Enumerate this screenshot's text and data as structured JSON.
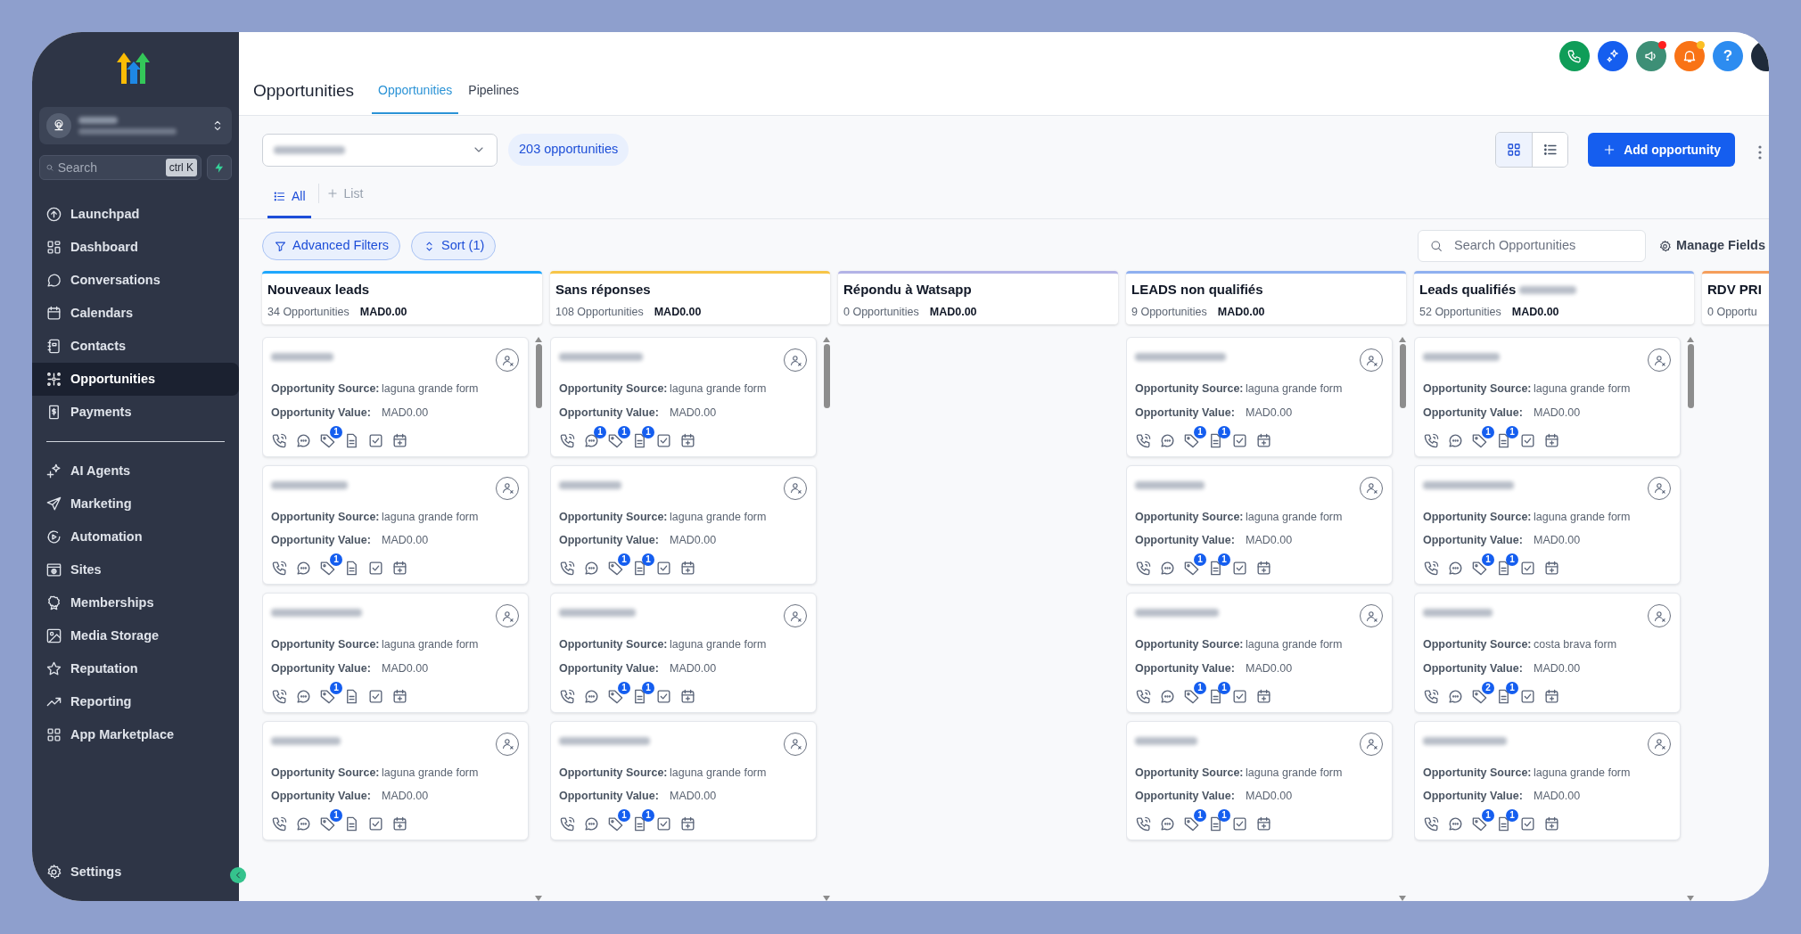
{
  "sidebar": {
    "search": {
      "placeholder": "Search",
      "shortcut": "ctrl K"
    },
    "nav_groups": [
      [
        {
          "label": "Launchpad",
          "selected": false
        },
        {
          "label": "Dashboard",
          "selected": false
        },
        {
          "label": "Conversations",
          "selected": false
        },
        {
          "label": "Calendars",
          "selected": false
        },
        {
          "label": "Contacts",
          "selected": false
        },
        {
          "label": "Opportunities",
          "selected": true
        },
        {
          "label": "Payments",
          "selected": false
        }
      ],
      [
        {
          "label": "AI Agents",
          "selected": false
        },
        {
          "label": "Marketing",
          "selected": false
        },
        {
          "label": "Automation",
          "selected": false
        },
        {
          "label": "Sites",
          "selected": false
        },
        {
          "label": "Memberships",
          "selected": false
        },
        {
          "label": "Media Storage",
          "selected": false
        },
        {
          "label": "Reputation",
          "selected": false
        },
        {
          "label": "Reporting",
          "selected": false
        },
        {
          "label": "App Marketplace",
          "selected": false
        }
      ]
    ],
    "settings": "Settings"
  },
  "header": {
    "title": "Opportunities",
    "tabs": [
      {
        "label": "Opportunities",
        "selected": true
      },
      {
        "label": "Pipelines",
        "selected": false
      }
    ],
    "help_label": "?"
  },
  "toolbar": {
    "count": "203 opportunities",
    "views": [
      {
        "kind": "grid",
        "selected": true
      },
      {
        "kind": "list",
        "selected": false
      }
    ],
    "add_button": "Add opportunity"
  },
  "smart_lists": {
    "items": [
      {
        "label": "All",
        "selected": true
      }
    ],
    "add_label": "List"
  },
  "filters": {
    "advanced": "Advanced Filters",
    "sort": "Sort (1)",
    "search_placeholder": "Search Opportunities",
    "manage_fields": "Manage Fields"
  },
  "columns": [
    {
      "title": "Nouveaux leads",
      "count": "34 Opportunities",
      "value": "MAD0.00",
      "color": "#1ea7fd",
      "cards": [
        {
          "source_label": "Opportunity Source:",
          "source": "laguna grande form",
          "value_label": "Opportunity Value:",
          "value": "MAD0.00",
          "badges": {
            "tag": "1"
          }
        },
        {
          "source_label": "Opportunity Source:",
          "source": "laguna grande form",
          "value_label": "Opportunity Value:",
          "value": "MAD0.00",
          "badges": {
            "tag": "1"
          }
        },
        {
          "source_label": "Opportunity Source:",
          "source": "laguna grande form",
          "value_label": "Opportunity Value:",
          "value": "MAD0.00",
          "badges": {
            "tag": "1"
          }
        },
        {
          "source_label": "Opportunity Source:",
          "source": "laguna grande form",
          "value_label": "Opportunity Value:",
          "value": "MAD0.00",
          "badges": {
            "tag": "1"
          }
        }
      ]
    },
    {
      "title": "Sans réponses",
      "count": "108 Opportunities",
      "value": "MAD0.00",
      "color": "#f7c548",
      "cards": [
        {
          "source_label": "Opportunity Source:",
          "source": "laguna grande form",
          "value_label": "Opportunity Value:",
          "value": "MAD0.00",
          "badges": {
            "chat": "1",
            "tag": "1",
            "note": "1"
          }
        },
        {
          "source_label": "Opportunity Source:",
          "source": "laguna grande form",
          "value_label": "Opportunity Value:",
          "value": "MAD0.00",
          "badges": {
            "tag": "1",
            "note": "1"
          }
        },
        {
          "source_label": "Opportunity Source:",
          "source": "laguna grande form",
          "value_label": "Opportunity Value:",
          "value": "MAD0.00",
          "badges": {
            "tag": "1",
            "note": "1"
          }
        },
        {
          "source_label": "Opportunity Source:",
          "source": "laguna grande form",
          "value_label": "Opportunity Value:",
          "value": "MAD0.00",
          "badges": {
            "tag": "1",
            "note": "1"
          }
        }
      ]
    },
    {
      "title": "Répondu à Watsapp",
      "count": "0 Opportunities",
      "value": "MAD0.00",
      "color": "#b3b3e6"
    },
    {
      "title": "LEADS non qualifiés",
      "count": "9 Opportunities",
      "value": "MAD0.00",
      "color": "#8fb0f0",
      "cards": [
        {
          "source_label": "Opportunity Source:",
          "source": "laguna grande form",
          "value_label": "Opportunity Value:",
          "value": "MAD0.00",
          "badges": {
            "tag": "1",
            "note": "1"
          }
        },
        {
          "source_label": "Opportunity Source:",
          "source": "laguna grande form",
          "value_label": "Opportunity Value:",
          "value": "MAD0.00",
          "badges": {
            "tag": "1",
            "note": "1"
          }
        },
        {
          "source_label": "Opportunity Source:",
          "source": "laguna grande form",
          "value_label": "Opportunity Value:",
          "value": "MAD0.00",
          "badges": {
            "tag": "1",
            "note": "1"
          }
        },
        {
          "source_label": "Opportunity Source:",
          "source": "laguna grande form",
          "value_label": "Opportunity Value:",
          "value": "MAD0.00",
          "badges": {
            "tag": "1",
            "note": "1"
          }
        }
      ]
    },
    {
      "title": "Leads qualifiés",
      "title_redacted": true,
      "count": "52 Opportunities",
      "value": "MAD0.00",
      "color": "#8fb0f0",
      "cards": [
        {
          "source_label": "Opportunity Source:",
          "source": "laguna grande form",
          "value_label": "Opportunity Value:",
          "value": "MAD0.00",
          "badges": {
            "tag": "1",
            "note": "1"
          }
        },
        {
          "source_label": "Opportunity Source:",
          "source": "laguna grande form",
          "value_label": "Opportunity Value:",
          "value": "MAD0.00",
          "badges": {
            "tag": "1",
            "note": "1"
          }
        },
        {
          "source_label": "Opportunity Source:",
          "source": "costa brava form",
          "value_label": "Opportunity Value:",
          "value": "MAD0.00",
          "badges": {
            "tag": "2",
            "note": "1"
          }
        },
        {
          "source_label": "Opportunity Source:",
          "source": "laguna grande form",
          "value_label": "Opportunity Value:",
          "value": "MAD0.00",
          "badges": {
            "tag": "1",
            "note": "1"
          }
        }
      ]
    },
    {
      "title": "RDV PRI",
      "count": "0 Opportu",
      "color": "#f59e5b"
    }
  ]
}
